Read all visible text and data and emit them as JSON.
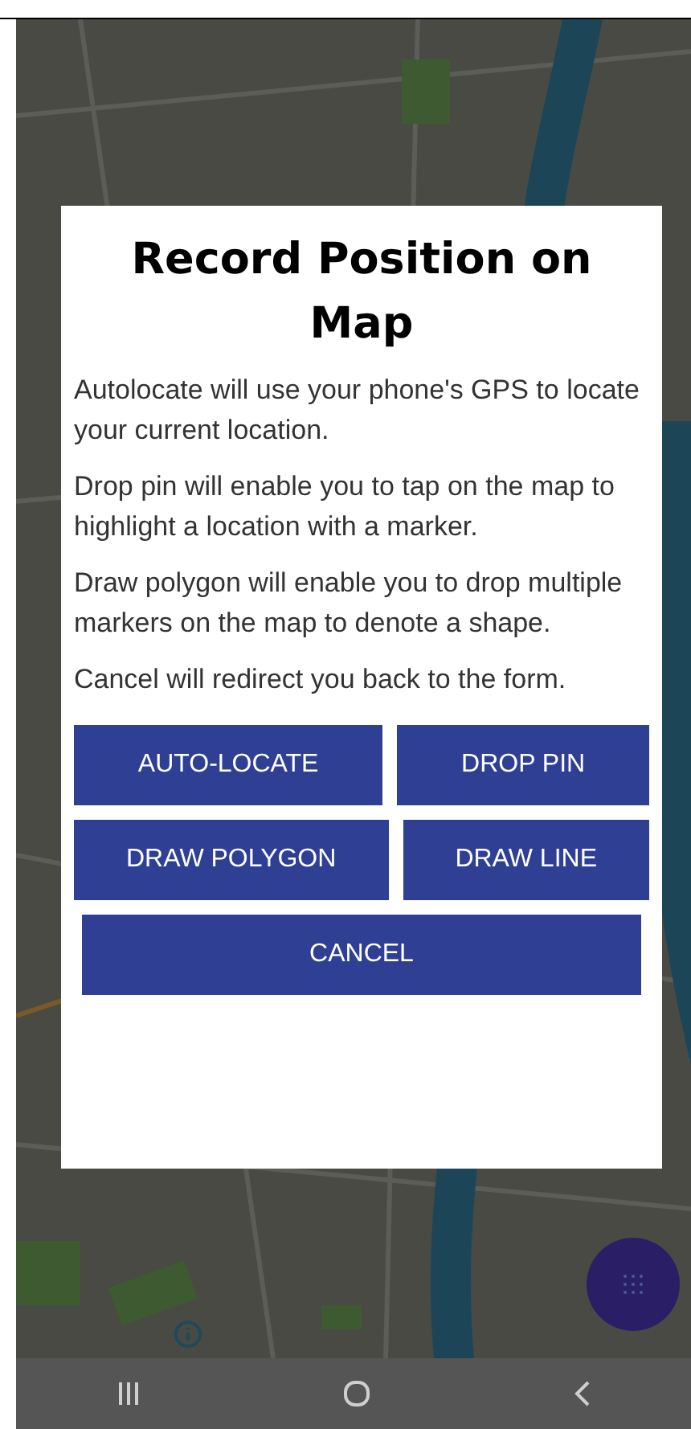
{
  "dialog": {
    "title": "Record Position on Map",
    "paragraphs": [
      "Autolocate will use your phone's GPS to locate your current location.",
      "Drop pin will enable you to tap on the map to highlight a location with a marker.",
      "Draw polygon will enable you to drop multiple markers on the map to denote a shape.",
      "Cancel will redirect you back to the form."
    ],
    "button_rows": [
      [
        "AUTO-LOCATE",
        "DROP PIN"
      ],
      [
        "DRAW POLYGON",
        "DRAW LINE"
      ],
      [
        "CANCEL"
      ]
    ]
  }
}
